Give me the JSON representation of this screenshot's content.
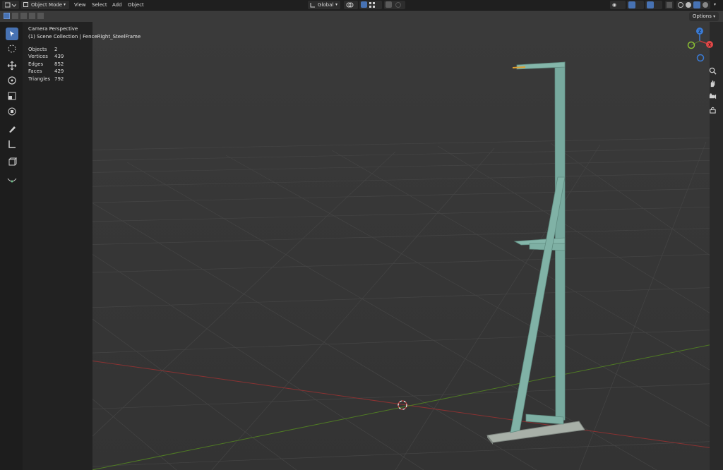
{
  "header": {
    "mode_label": "Object Mode",
    "menu": [
      "View",
      "Select",
      "Add",
      "Object"
    ],
    "orientation_label": "Global"
  },
  "options_label": "Options",
  "overlay": {
    "view_name": "Camera Perspective",
    "collection_path": "(1) Scene Collection | FenceRight_SteelFrame"
  },
  "stats": [
    {
      "label": "Objects",
      "value": "2"
    },
    {
      "label": "Vertices",
      "value": "439"
    },
    {
      "label": "Edges",
      "value": "852"
    },
    {
      "label": "Faces",
      "value": "429"
    },
    {
      "label": "Triangles",
      "value": "792"
    }
  ],
  "gizmo": {
    "z_label": "Z",
    "x_label": "X"
  },
  "colors": {
    "accent": "#4772b3",
    "x_axis": "#c43a3a",
    "y_axis": "#6a9e2c",
    "z_axis": "#3a7bd5",
    "object": "#7eb0a4"
  }
}
